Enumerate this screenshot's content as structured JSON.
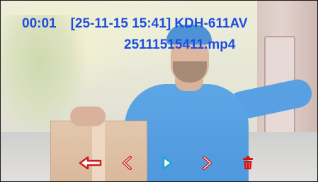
{
  "playback": {
    "elapsed": "00:01",
    "record_info": "[25-11-15 15:41] KDH-611AV",
    "filename": "25111515411.mp4",
    "text_color": "#1d4ee0"
  },
  "controls": [
    {
      "id": "back",
      "icon": "back-arrow-icon",
      "color": "#cc1f1f"
    },
    {
      "id": "previous",
      "icon": "chevron-left-icon",
      "color": "#cc1f1f"
    },
    {
      "id": "play",
      "icon": "play-icon",
      "color": "#19a7c9"
    },
    {
      "id": "next",
      "icon": "chevron-right-icon",
      "color": "#cc1f1f"
    },
    {
      "id": "delete",
      "icon": "trash-icon",
      "color": "#d11414"
    }
  ]
}
